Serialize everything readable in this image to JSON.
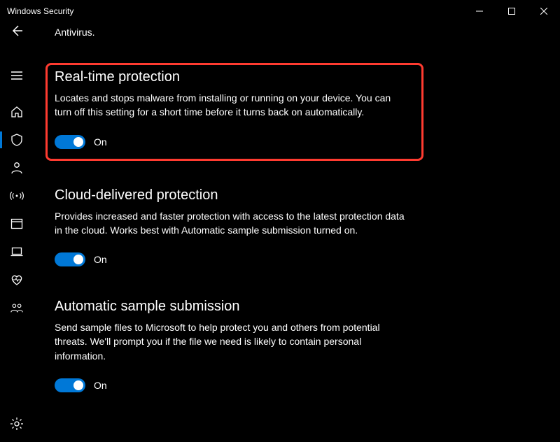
{
  "window": {
    "title": "Windows Security"
  },
  "top_text": "Antivirus.",
  "sidebar": {
    "items": [
      {
        "id": "menu",
        "icon": "menu-icon"
      },
      {
        "id": "home",
        "icon": "home-icon"
      },
      {
        "id": "virus",
        "icon": "shield-icon",
        "active": true
      },
      {
        "id": "account",
        "icon": "person-icon"
      },
      {
        "id": "firewall",
        "icon": "signal-icon"
      },
      {
        "id": "app",
        "icon": "window-icon"
      },
      {
        "id": "device",
        "icon": "laptop-icon"
      },
      {
        "id": "performance",
        "icon": "heart-icon"
      },
      {
        "id": "family",
        "icon": "people-icon"
      }
    ],
    "settings": {
      "id": "settings",
      "icon": "gear-icon"
    }
  },
  "sections": {
    "realtime": {
      "title": "Real-time protection",
      "desc": "Locates and stops malware from installing or running on your device. You can turn off this setting for a short time before it turns back on automatically.",
      "toggle_state": "On"
    },
    "cloud": {
      "title": "Cloud-delivered protection",
      "desc": "Provides increased and faster protection with access to the latest protection data in the cloud. Works best with Automatic sample submission turned on.",
      "toggle_state": "On"
    },
    "sample": {
      "title": "Automatic sample submission",
      "desc": "Send sample files to Microsoft to help protect you and others from potential threats. We'll prompt you if the file we need is likely to contain personal information.",
      "toggle_state": "On"
    }
  }
}
